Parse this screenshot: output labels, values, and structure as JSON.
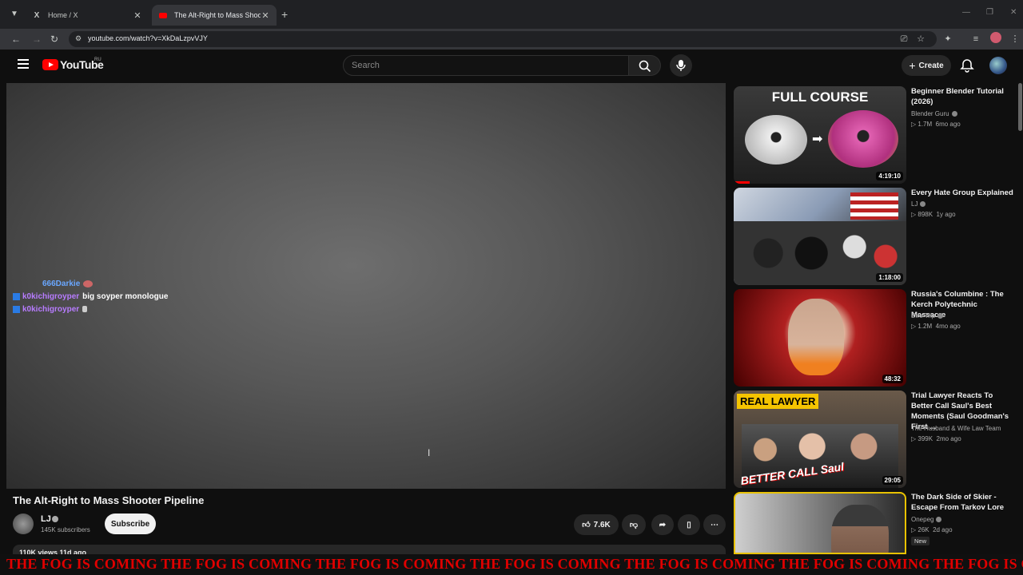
{
  "browser": {
    "tabs": [
      {
        "title": "Home / X",
        "icon": "x-logo-icon",
        "active": false
      },
      {
        "title": "The Alt-Right to Mass Shooter Pipeline",
        "icon": "youtube-icon",
        "active": true
      }
    ],
    "url": "youtube.com/watch?v=XkDaLzpvVJY"
  },
  "header": {
    "logo": "YouTube",
    "region": "RU",
    "search_placeholder": "Search",
    "create_label": "Create"
  },
  "chat": [
    {
      "user": "666Darkie",
      "message": ""
    },
    {
      "user": "k0kichigroyper",
      "message": "big soyper monologue"
    },
    {
      "user": "k0kichigroyper",
      "message": ""
    }
  ],
  "video": {
    "title": "The Alt-Right to Mass Shooter Pipeline",
    "channel": "LJ",
    "subscribers": "145K subscribers",
    "subscribe_label": "Subscribe",
    "likes": "7.6K",
    "views_line": "110K views  11d ago"
  },
  "recommendations": [
    {
      "title": "Beginner Blender Tutorial (2026)",
      "channel": "Blender Guru",
      "views": "1.7M",
      "age": "6mo ago",
      "duration": "4:19:10",
      "thumb_text": "FULL COURSE"
    },
    {
      "title": "Every Hate Group Explained",
      "channel": "LJ",
      "views": "898K",
      "age": "1y ago",
      "duration": "1:18:00"
    },
    {
      "title": "Russia's Columbine : The Kerch Polytechnic Massacre",
      "channel": "Dire Trip",
      "views": "1.2M",
      "age": "4mo ago",
      "duration": "48:32"
    },
    {
      "title": "Trial Lawyer Reacts To Better Call Saul's Best Moments (Saul Goodman's First ...",
      "channel": "The Husband & Wife Law Team",
      "views": "399K",
      "age": "2mo ago",
      "duration": "29:05",
      "thumb_text": "REAL LAWYER",
      "thumb_text2": "BETTER CALL Saul"
    },
    {
      "title": "The Dark Side of Skier - Escape From Tarkov Lore",
      "channel": "Onepeg",
      "views": "26K",
      "age": "2d ago",
      "badge": "New"
    }
  ],
  "overlay_text": "THE FOG IS COMING THE FOG IS COMING THE FOG IS COMING THE FOG IS COMING THE FOG IS COMING THE FOG IS COMING THE FOG IS COMING",
  "colors": {
    "accent": "#ff0000",
    "overlay": "#e00000",
    "chat_user1": "#6aa7ff",
    "chat_user2": "#b77cff"
  }
}
